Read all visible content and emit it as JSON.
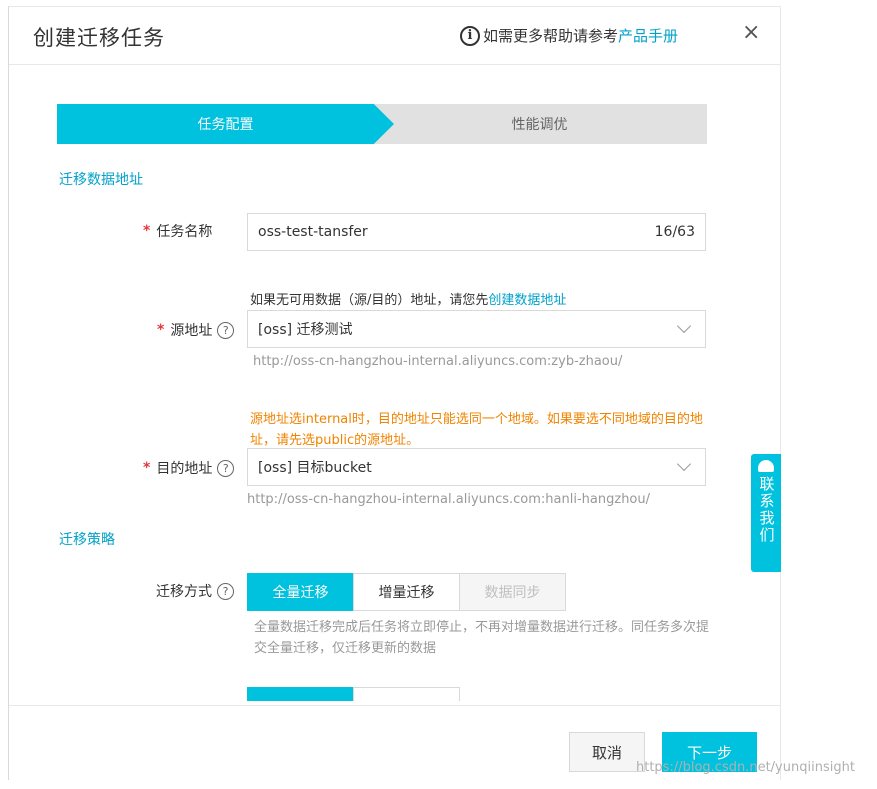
{
  "dialog": {
    "title": "创建迁移任务",
    "help_text": "如需更多帮助请参考",
    "help_link": "产品手册",
    "close_icon": "×"
  },
  "steps": [
    {
      "label": "任务配置",
      "active": true
    },
    {
      "label": "性能调优",
      "active": false
    }
  ],
  "sections": {
    "address_title": "迁移数据地址",
    "strategy_title": "迁移策略"
  },
  "task_name": {
    "label": "任务名称",
    "value": "oss-test-tansfer",
    "counter": "16/63"
  },
  "source": {
    "hint_prefix": "如果无可用数据（源/目的）地址，请您先",
    "hint_link": "创建数据地址",
    "label": "源地址",
    "value": "[oss] 迁移测试",
    "url": "http://oss-cn-hangzhou-internal.aliyuncs.com:zyb-zhaou/"
  },
  "warning": "源地址选internal时，目的地址只能选同一个地域。如果要选不同地域的目的地址，请先选public的源地址。",
  "destination": {
    "label": "目的地址",
    "value": "[oss] 目标bucket",
    "url": "http://oss-cn-hangzhou-internal.aliyuncs.com:hanli-hangzhou/"
  },
  "migration_mode": {
    "label": "迁移方式",
    "options": [
      {
        "label": "全量迁移",
        "state": "active"
      },
      {
        "label": "增量迁移",
        "state": "normal"
      },
      {
        "label": "数据同步",
        "state": "disabled"
      }
    ],
    "description": "全量数据迁移完成后任务将立即停止，不再对增量数据进行迁移。同任务多次提交全量迁移，仅迁移更新的数据"
  },
  "footer": {
    "cancel_label": "取消",
    "next_label": "下一步"
  },
  "contact_widget": "联系我们",
  "watermark": "https://blog.csdn.net/yunqiinsight",
  "colors": {
    "accent": "#00c1de",
    "link": "#00a2ca",
    "warning": "#f08300",
    "required": "#e5363d"
  }
}
